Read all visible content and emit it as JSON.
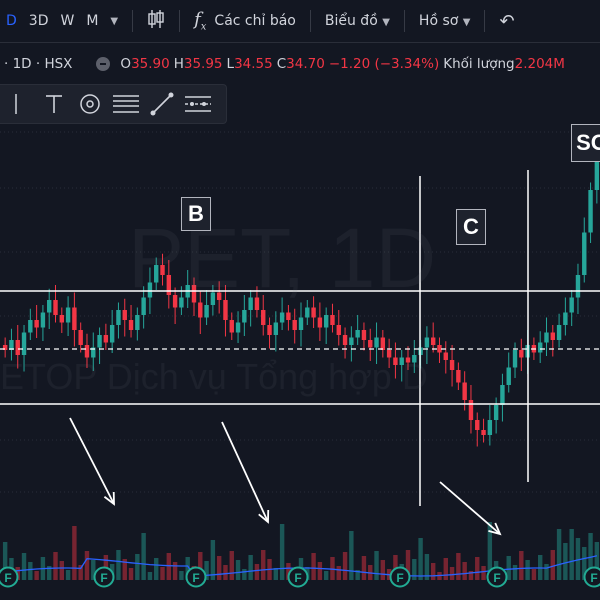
{
  "toolbar": {
    "interval_d": "D",
    "interval_3d": "3D",
    "interval_w": "W",
    "interval_m": "M",
    "indicators": "Các chỉ báo",
    "chart": "Biểu đồ",
    "profile": "Hồ sơ"
  },
  "legend": {
    "symbol_info": "· 1D · HSX",
    "open_label": "O",
    "open": "35.90",
    "high_label": "H",
    "high": "35.95",
    "low_label": "L",
    "low": "34.55",
    "close_label": "C",
    "close": "34.70",
    "change": "−1.20 (−3.34%)",
    "volume_label": "Khối lượng",
    "volume": "2.204M"
  },
  "tools": [
    "text-cursor-icon",
    "text-tool-icon",
    "target-icon",
    "fib-lines-icon",
    "trend-line-icon",
    "pattern-icon"
  ],
  "annotations": {
    "b": "B",
    "c": "C",
    "so": "SO"
  },
  "watermark": {
    "title": "PET, 1D",
    "subtitle": "ETOP Dịch vụ Tổng hợp D"
  },
  "colors": {
    "up": "#26a69a",
    "down": "#f23645",
    "volume_ma": "#2962ff",
    "accent": "#2962ff",
    "bg": "#131722"
  },
  "chart_data": {
    "type": "candlestick",
    "closes": [
      33.8,
      34.2,
      33.6,
      34.5,
      35.0,
      34.7,
      35.3,
      35.8,
      35.2,
      34.9,
      35.5,
      34.6,
      34.0,
      33.5,
      33.9,
      34.4,
      34.1,
      34.8,
      35.4,
      35.0,
      34.6,
      35.2,
      35.9,
      36.5,
      37.2,
      36.8,
      36.0,
      35.5,
      35.9,
      36.4,
      35.7,
      35.1,
      35.6,
      36.1,
      35.8,
      35.0,
      34.5,
      34.9,
      35.4,
      35.9,
      35.4,
      34.8,
      34.4,
      34.9,
      35.3,
      35.0,
      34.6,
      35.1,
      35.5,
      35.1,
      34.7,
      35.2,
      34.8,
      34.4,
      34.0,
      34.3,
      34.6,
      34.2,
      33.9,
      34.3,
      33.8,
      33.5,
      33.2,
      33.5,
      33.3,
      33.6,
      33.9,
      34.3,
      34.0,
      33.7,
      33.4,
      33.0,
      32.5,
      31.8,
      31.0,
      30.6,
      30.4,
      31.0,
      31.6,
      32.4,
      33.1,
      33.8,
      33.5,
      34.0,
      33.7,
      34.1,
      34.5,
      34.2,
      34.8,
      35.3,
      35.9,
      36.8,
      38.5,
      40.2,
      41.6
    ],
    "volume_markers": [
      "F",
      "F",
      "F",
      "F",
      "F",
      "F",
      "F"
    ],
    "horizontal_levels": [
      "upper-range",
      "mid-dashed",
      "lower-range"
    ]
  }
}
